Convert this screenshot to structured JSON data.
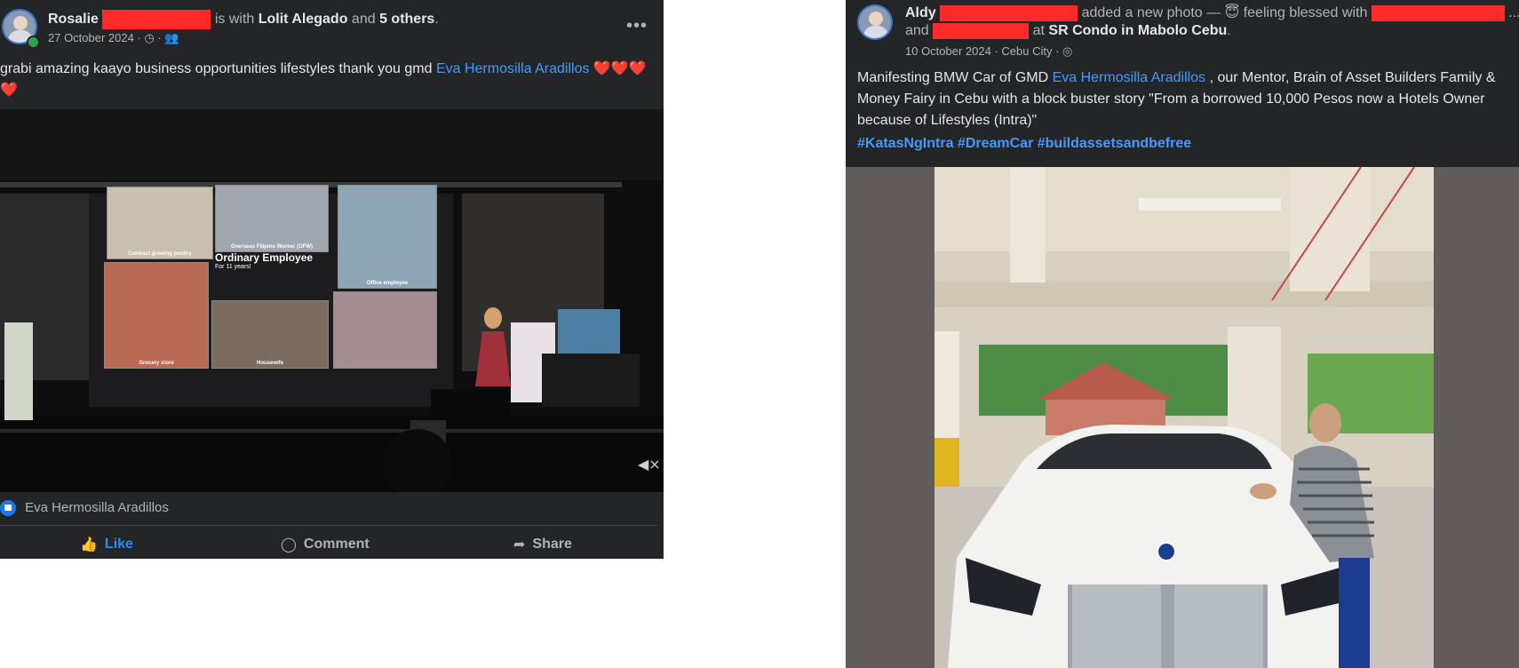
{
  "post1": {
    "author": "Rosalie",
    "with_prefix": "is with",
    "tagged_person": "Lolit Alegado",
    "and_word": "and",
    "others": "5 others",
    "period": ".",
    "date": "27 October 2024",
    "more_label": "•••",
    "text_prefix": "grabi amazing kaayo business opportunities lifestyles thank you gmd",
    "text_link": "Eva Hermosilla Aradillos",
    "hearts": "❤️❤️❤️❤️",
    "slides": {
      "caption1": "Contract growing poultry",
      "caption2": "Overseas Filipino Worker (OFW)",
      "heading": "Ordinary Employee",
      "subheading": "For 11 years!",
      "caption3": "Office employee",
      "caption4": "Grocery store",
      "caption5": "Housewife"
    },
    "reaction_name": "Eva Hermosilla Aradillos",
    "actions": {
      "like": "Like",
      "comment": "Comment",
      "share": "Share"
    }
  },
  "post2": {
    "author": "Aldy",
    "added_text": "added a new photo — 😇 feeling blessed with",
    "ellipsis": "...",
    "and_word": "and",
    "at_word": "at",
    "location": "SR Condo in Mabolo Cebu",
    "period": ".",
    "date": "10 October 2024 · Cebu City ·",
    "more_label": "•••",
    "text_p1": "Manifesting BMW Car of GMD",
    "text_link": "Eva Hermosilla Aradillos",
    "text_p2": ", our Mentor, Brain of Asset Builders Family &  Money Fairy in Cebu with a block buster story \"From a borrowed 10,000 Pesos now a Hotels Owner because of Lifestyles (Intra)\"",
    "hashtags": "#KatasNgIntra #DreamCar #buildassetsandbefree"
  },
  "colors": {
    "card_bg": "#242526",
    "text": "#e4e6eb",
    "muted": "#b0b3b8",
    "link": "#4599ff",
    "like_blue": "#1877f2",
    "redaction": "#ff2a2a"
  }
}
